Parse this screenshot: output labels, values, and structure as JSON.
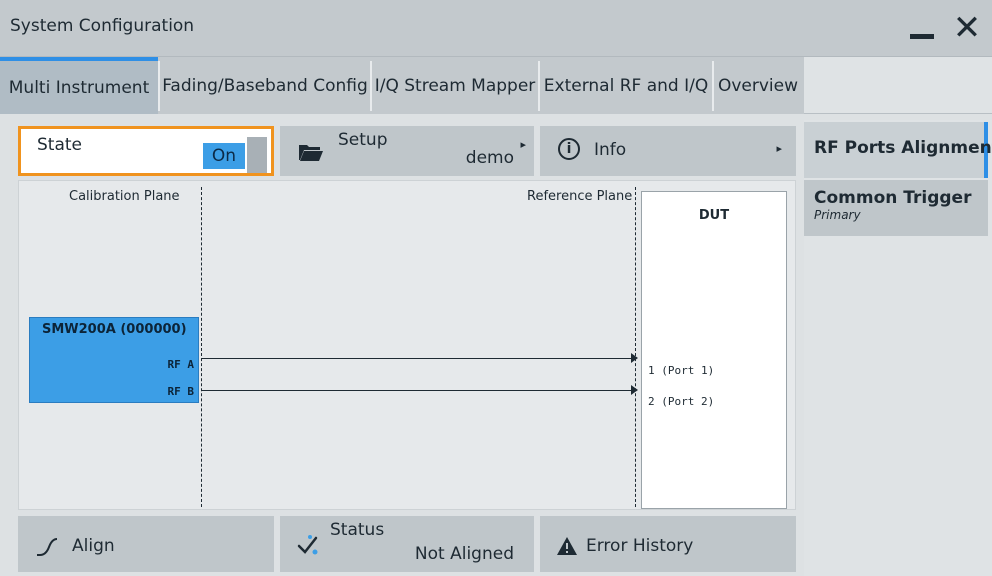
{
  "window": {
    "title": "System Configuration",
    "close_glyph": "✕"
  },
  "tabs": [
    {
      "label": "Multi Instrument",
      "active": true
    },
    {
      "label": "Fading/Baseband Config"
    },
    {
      "label": "I/Q Stream Mapper"
    },
    {
      "label": "External RF and I/Q"
    },
    {
      "label": "Overview"
    }
  ],
  "toolbar": {
    "state_label": "State",
    "state_value": "On",
    "setup_label": "Setup",
    "setup_value": "demo",
    "info_label": "Info",
    "info_glyph": "i",
    "arrow_glyph": "▸"
  },
  "diagram": {
    "calibration_plane": "Calibration Plane",
    "reference_plane": "Reference Plane",
    "dut_label": "DUT",
    "instrument": {
      "name": "SMW200A (000000)",
      "ports": [
        "RF A",
        "RF B"
      ]
    },
    "dut_ports": [
      "1 (Port 1)",
      "2 (Port 2)"
    ]
  },
  "side_panel": {
    "items": [
      {
        "label": "RF Ports Alignment",
        "sub": "",
        "active": true
      },
      {
        "label": "Common Trigger",
        "sub": "Primary"
      }
    ]
  },
  "bottom": {
    "align_label": "Align",
    "status_label": "Status",
    "status_value": "Not Aligned",
    "error_history_label": "Error History"
  },
  "colors": {
    "accent_blue": "#3c9ee6",
    "highlight_orange": "#f0931e",
    "tab_active_bar": "#2e8fe6"
  }
}
